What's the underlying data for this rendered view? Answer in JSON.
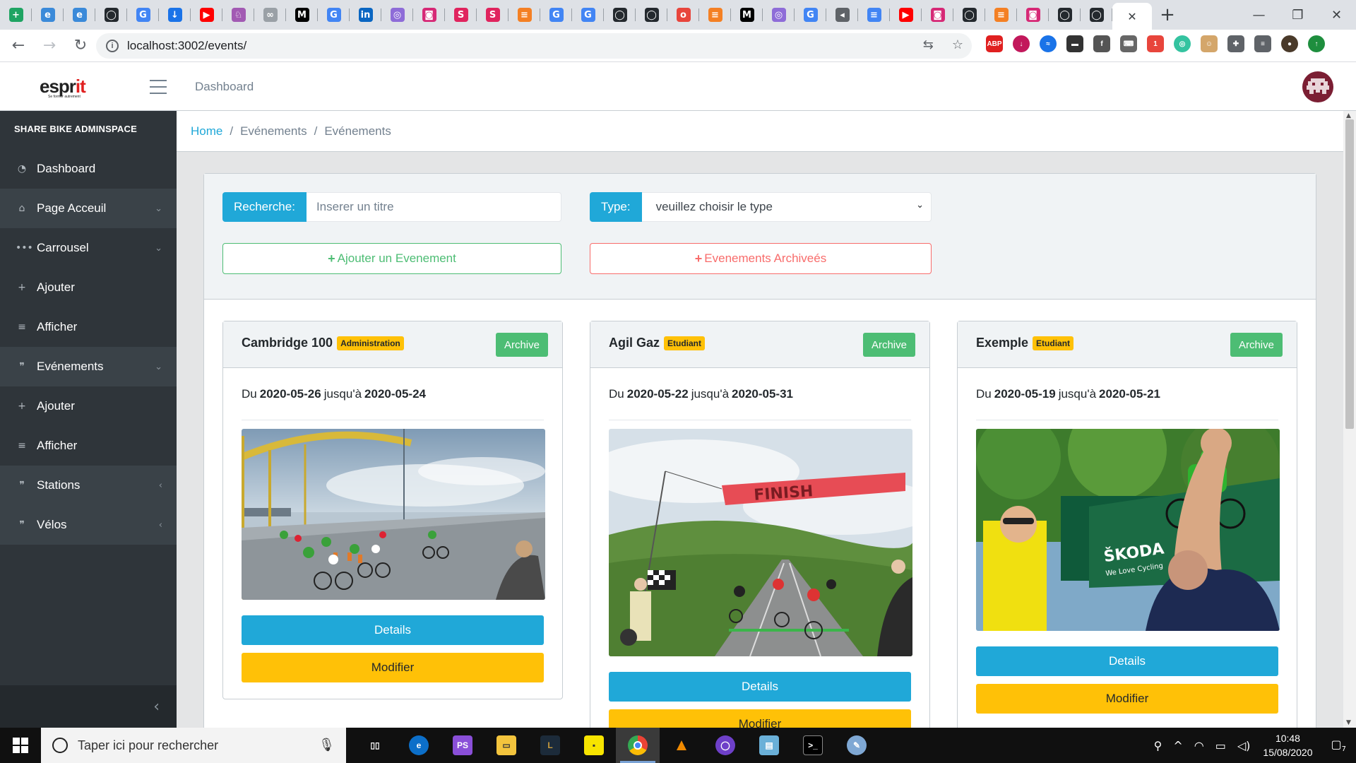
{
  "browser": {
    "url": "localhost:3002/events/",
    "tabs": [
      {
        "icon": "sheets-icon",
        "color": "#1fa463",
        "glyph": "+"
      },
      {
        "icon": "edge-icon",
        "color": "#3b8ad9",
        "glyph": "e"
      },
      {
        "icon": "edge-icon",
        "color": "#3b8ad9",
        "glyph": "e"
      },
      {
        "icon": "github-icon",
        "color": "#24292e",
        "glyph": "◯"
      },
      {
        "icon": "google-icon",
        "color": "#4285f4",
        "glyph": "G"
      },
      {
        "icon": "download-icon",
        "color": "#1a73e8",
        "glyph": "↓"
      },
      {
        "icon": "youtube-icon",
        "color": "#ff0000",
        "glyph": "▶"
      },
      {
        "icon": "web-icon",
        "color": "#a25ab3",
        "glyph": "♘"
      },
      {
        "icon": "web-icon",
        "color": "#9aa0a6",
        "glyph": "∞"
      },
      {
        "icon": "medium-icon",
        "color": "#000000",
        "glyph": "M"
      },
      {
        "icon": "google-icon",
        "color": "#4285f4",
        "glyph": "G"
      },
      {
        "icon": "linkedin-icon",
        "color": "#0a66c2",
        "glyph": "in"
      },
      {
        "icon": "web-icon",
        "color": "#8e6cd8",
        "glyph": "◎"
      },
      {
        "icon": "instagram-icon",
        "color": "#d62976",
        "glyph": "◙"
      },
      {
        "icon": "web-icon",
        "color": "#e0245e",
        "glyph": "S"
      },
      {
        "icon": "web-icon",
        "color": "#e0245e",
        "glyph": "S"
      },
      {
        "icon": "stackoverflow-icon",
        "color": "#f48024",
        "glyph": "≡"
      },
      {
        "icon": "google-icon",
        "color": "#4285f4",
        "glyph": "G"
      },
      {
        "icon": "google-icon",
        "color": "#4285f4",
        "glyph": "G"
      },
      {
        "icon": "github-icon",
        "color": "#24292e",
        "glyph": "◯"
      },
      {
        "icon": "github-icon",
        "color": "#24292e",
        "glyph": "◯"
      },
      {
        "icon": "web-icon",
        "color": "#e8453c",
        "glyph": "o"
      },
      {
        "icon": "stackoverflow-icon",
        "color": "#f48024",
        "glyph": "≡"
      },
      {
        "icon": "medium-icon",
        "color": "#000000",
        "glyph": "M"
      },
      {
        "icon": "web-icon",
        "color": "#8e6cd8",
        "glyph": "◎"
      },
      {
        "icon": "google-icon",
        "color": "#4285f4",
        "glyph": "G"
      },
      {
        "icon": "audio-icon",
        "color": "#5f6368",
        "glyph": "◂"
      },
      {
        "icon": "docs-icon",
        "color": "#4285f4",
        "glyph": "≡"
      },
      {
        "icon": "youtube-icon",
        "color": "#ff0000",
        "glyph": "▶"
      },
      {
        "icon": "instagram-icon",
        "color": "#d62976",
        "glyph": "◙"
      },
      {
        "icon": "github-icon",
        "color": "#24292e",
        "glyph": "◯"
      },
      {
        "icon": "stackoverflow-icon",
        "color": "#f48024",
        "glyph": "≡"
      },
      {
        "icon": "instagram-icon",
        "color": "#d62976",
        "glyph": "◙"
      },
      {
        "icon": "github-icon",
        "color": "#24292e",
        "glyph": "◯"
      },
      {
        "icon": "github-icon",
        "color": "#24292e",
        "glyph": "◯"
      }
    ],
    "close_glyph": "✕",
    "new_tab_glyph": "+"
  },
  "header": {
    "logo_main": "espr",
    "logo_accent": "it",
    "logo_tagline": "Se former autrement",
    "nav_link": "Dashboard"
  },
  "sidebar": {
    "title": "SHARE BIKE ADMINSPACE",
    "items": [
      {
        "label": "Dashboard",
        "icon": "dashboard-icon",
        "glyph": "◔",
        "arrow": ""
      },
      {
        "label": "Page Acceuil",
        "icon": "home-icon",
        "glyph": "⌂",
        "arrow": "⌄"
      },
      {
        "label": "Carrousel",
        "icon": "ellipsis-icon",
        "glyph": "•••",
        "arrow": "⌄"
      },
      {
        "label": "Ajouter",
        "icon": "plus-icon",
        "glyph": "+",
        "arrow": ""
      },
      {
        "label": "Afficher",
        "icon": "list-icon",
        "glyph": "≡",
        "arrow": ""
      },
      {
        "label": "Evénements",
        "icon": "quote-icon",
        "glyph": "❞",
        "arrow": "⌄"
      },
      {
        "label": "Ajouter",
        "icon": "plus-icon",
        "glyph": "+",
        "arrow": ""
      },
      {
        "label": "Afficher",
        "icon": "list-icon",
        "glyph": "≡",
        "arrow": ""
      },
      {
        "label": "Stations",
        "icon": "quote-icon",
        "glyph": "❞",
        "arrow": "‹"
      },
      {
        "label": "Vélos",
        "icon": "quote-icon",
        "glyph": "❞",
        "arrow": "‹"
      }
    ],
    "toggle_glyph": "‹"
  },
  "breadcrumb": [
    "Home",
    "Evénements",
    "Evénements"
  ],
  "filters": {
    "search_label": "Recherche:",
    "search_placeholder": "Inserer un titre",
    "type_label": "Type:",
    "type_selected": "veuillez choisir le type",
    "add_button": "Ajouter un Evenement",
    "archived_button": "Evenements Archiveés"
  },
  "events": [
    {
      "title": "Cambridge 100",
      "badge": "Administration",
      "archive": "Archive",
      "du": "Du",
      "start": "2020-05-26",
      "jusqua": "jusqu'à",
      "end": "2020-05-24",
      "details": "Details",
      "modifier": "Modifier"
    },
    {
      "title": "Agil Gaz",
      "badge": "Etudiant",
      "archive": "Archive",
      "du": "Du",
      "start": "2020-05-22",
      "jusqua": "jusqu'à",
      "end": "2020-05-31",
      "details": "Details",
      "modifier": "Modifier",
      "banner": "FINISH"
    },
    {
      "title": "Exemple",
      "badge": "Etudiant",
      "archive": "Archive",
      "du": "Du",
      "start": "2020-05-19",
      "jusqua": "jusqu'à",
      "end": "2020-05-21",
      "details": "Details",
      "modifier": "Modifier",
      "sign_brand": "ŠKODA",
      "sign_slogan": "We Love Cycling"
    }
  ],
  "taskbar": {
    "search_placeholder": "Taper ici pour rechercher",
    "time": "10:48",
    "date": "15/08/2020",
    "notifications": "7"
  },
  "colors": {
    "primary": "#20a8d8",
    "success": "#4dbd74",
    "danger": "#f86c6b",
    "warning": "#ffc107",
    "sidebar": "#2f353a"
  }
}
